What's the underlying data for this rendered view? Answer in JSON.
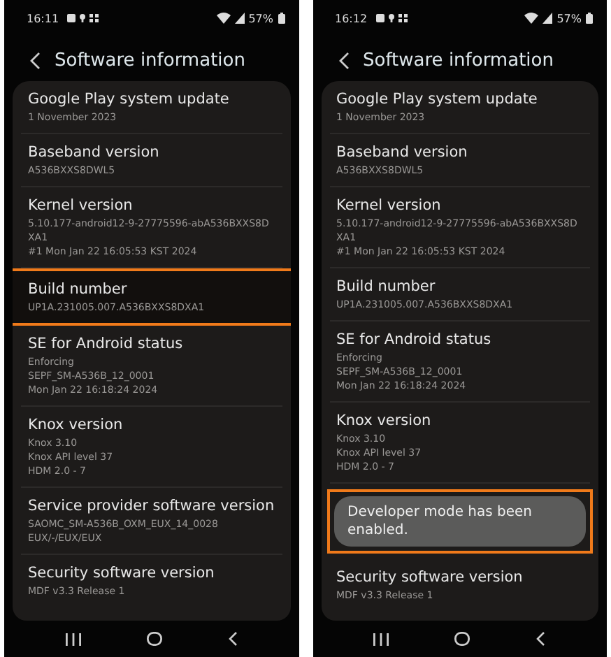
{
  "phones": [
    {
      "status": {
        "time": "16:11",
        "battery": "57%"
      },
      "title": "Software information",
      "items": [
        {
          "kind": "setting",
          "title": "Google Play system update",
          "lines": [
            "1 November 2023"
          ],
          "highlighted": false
        },
        {
          "kind": "setting",
          "title": "Baseband version",
          "lines": [
            "A536BXXS8DWL5"
          ],
          "highlighted": false
        },
        {
          "kind": "setting",
          "title": "Kernel version",
          "lines": [
            "5.10.177-android12-9-27775596-abA536BXXS8DXA1",
            "#1 Mon Jan 22 16:05:53 KST 2024"
          ],
          "highlighted": false
        },
        {
          "kind": "setting",
          "title": "Build number",
          "lines": [
            "UP1A.231005.007.A536BXXS8DXA1"
          ],
          "highlighted": true
        },
        {
          "kind": "setting",
          "title": "SE for Android status",
          "lines": [
            "Enforcing",
            "SEPF_SM-A536B_12_0001",
            "Mon Jan 22 16:18:24 2024"
          ],
          "highlighted": false
        },
        {
          "kind": "setting",
          "title": "Knox version",
          "lines": [
            "Knox 3.10",
            "Knox API level 37",
            "HDM 2.0 - 7"
          ],
          "highlighted": false
        },
        {
          "kind": "setting",
          "title": "Service provider software version",
          "lines": [
            "SAOMC_SM-A536B_OXM_EUX_14_0028",
            "EUX/-/EUX/EUX"
          ],
          "highlighted": false
        },
        {
          "kind": "setting",
          "title": "Security software version",
          "lines": [
            "MDF v3.3 Release 1"
          ],
          "highlighted": false
        }
      ]
    },
    {
      "status": {
        "time": "16:12",
        "battery": "57%"
      },
      "title": "Software information",
      "items": [
        {
          "kind": "setting",
          "title": "Google Play system update",
          "lines": [
            "1 November 2023"
          ],
          "highlighted": false
        },
        {
          "kind": "setting",
          "title": "Baseband version",
          "lines": [
            "A536BXXS8DWL5"
          ],
          "highlighted": false
        },
        {
          "kind": "setting",
          "title": "Kernel version",
          "lines": [
            "5.10.177-android12-9-27775596-abA536BXXS8DXA1",
            "#1 Mon Jan 22 16:05:53 KST 2024"
          ],
          "highlighted": false
        },
        {
          "kind": "setting",
          "title": "Build number",
          "lines": [
            "UP1A.231005.007.A536BXXS8DXA1"
          ],
          "highlighted": false
        },
        {
          "kind": "setting",
          "title": "SE for Android status",
          "lines": [
            "Enforcing",
            "SEPF_SM-A536B_12_0001",
            "Mon Jan 22 16:18:24 2024"
          ],
          "highlighted": false
        },
        {
          "kind": "setting",
          "title": "Knox version",
          "lines": [
            "Knox 3.10",
            "Knox API level 37",
            "HDM 2.0 - 7"
          ],
          "highlighted": false
        },
        {
          "kind": "toast",
          "text": "Developer mode has been enabled.",
          "highlighted": true
        },
        {
          "kind": "setting",
          "title": "Security software version",
          "lines": [
            "MDF v3.3 Release 1"
          ],
          "highlighted": false
        }
      ]
    }
  ]
}
